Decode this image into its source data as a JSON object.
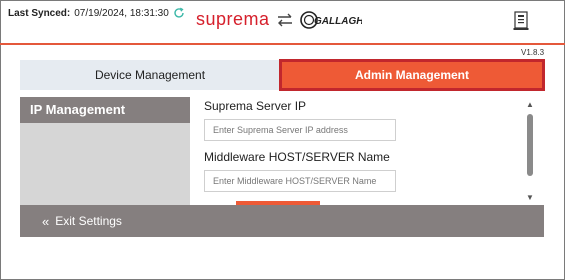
{
  "header": {
    "last_synced_label": "Last Synced:",
    "last_synced_value": "07/19/2024, 18:31:30",
    "brand_left": "suprema",
    "brand_right": "GALLAGHER",
    "version": "V1.8.3"
  },
  "tabs": [
    {
      "label": "Device Management",
      "active": false
    },
    {
      "label": "Admin Management",
      "active": true
    }
  ],
  "sidebar": {
    "title": "IP Management"
  },
  "form": {
    "server_ip_label": "Suprema Server IP",
    "server_ip_placeholder": "Enter Suprema Server IP address",
    "server_ip_value": "",
    "middleware_label": "Middleware HOST/SERVER Name",
    "middleware_placeholder": "Enter Middleware HOST/SERVER Name",
    "middleware_value": ""
  },
  "footer": {
    "exit_label": "Exit Settings"
  },
  "colors": {
    "accent": "#ee5a36",
    "active_tab_border": "#c1272d",
    "brand_red": "#d6202c",
    "panel_gray": "#857f7f",
    "inactive_tab": "#e6ebf1",
    "sync_icon": "#3cb8a8"
  },
  "icons": {
    "sync": "refresh-icon",
    "swap": "swap-arrows-icon",
    "document": "document-report-icon",
    "exit": "double-chevron-left-icon"
  }
}
